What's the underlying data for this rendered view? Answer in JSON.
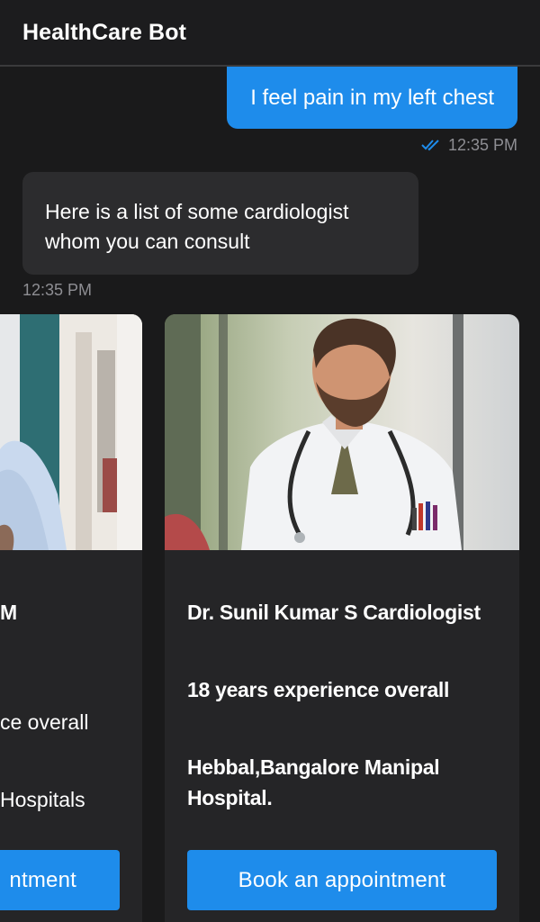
{
  "header": {
    "title": "HealthCare Bot"
  },
  "messages": {
    "outgoing": {
      "text": "I feel pain in my left chest",
      "time": "12:35 PM",
      "status_icon": "double-check-icon"
    },
    "incoming": {
      "lines": [
        "Here is a list of some cardiologist",
        "whom you can consult"
      ],
      "time": "12:35 PM"
    }
  },
  "doctors": [
    {
      "name_fragment": "M",
      "experience_fragment": "ce overall",
      "location_fragment": "Hospitals",
      "button_fragment": "ntment"
    },
    {
      "name": "Dr. Sunil Kumar S Cardiologist",
      "experience": "18 years experience overall",
      "location_lines": [
        "Hebbal,Bangalore Manipal",
        "Hospital."
      ],
      "button_label": "Book an appointment"
    }
  ],
  "colors": {
    "accent": "#1e8ceb",
    "background": "#1a1a1b",
    "card": "#252527",
    "bubble": "#2c2c2e",
    "muted": "#8e8e93"
  }
}
